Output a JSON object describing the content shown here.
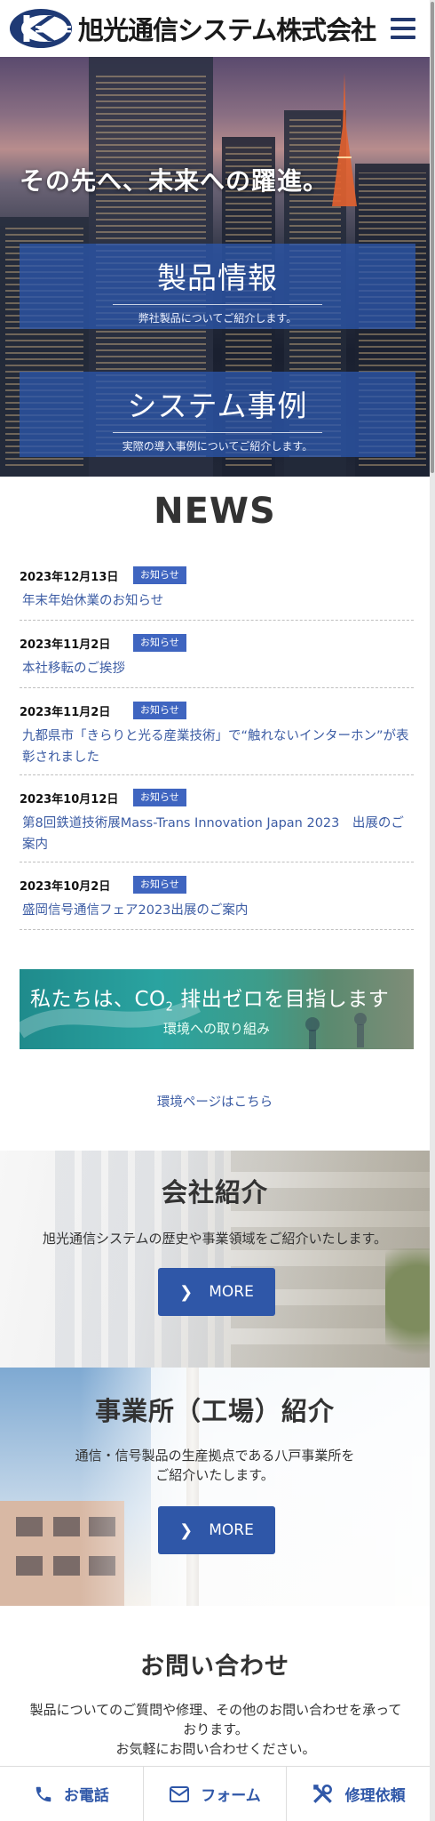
{
  "header": {
    "company_name": "旭光通信システム株式会社",
    "brand_color": "#1f3a75",
    "menu_icon": "hamburger-menu-icon"
  },
  "hero": {
    "tagline": "その先へ、未来への躍進。",
    "boxes": [
      {
        "title": "製品情報",
        "subtitle": "弊社製品についてご紹介します。"
      },
      {
        "title": "システム事例",
        "subtitle": "実際の導入事例についてご紹介します。"
      }
    ]
  },
  "news": {
    "heading": "NEWS",
    "badge_color": "#3f65c0",
    "items": [
      {
        "date": "2023年12月13日",
        "category": "お知らせ",
        "title": "年末年始休業のお知らせ"
      },
      {
        "date": "2023年11月2日",
        "category": "お知らせ",
        "title": "本社移転のご挨拶"
      },
      {
        "date": "2023年11月2日",
        "category": "お知らせ",
        "title": "九都県市「きらりと光る産業技術」で“触れないインターホン”が表彰されました"
      },
      {
        "date": "2023年10月12日",
        "category": "お知らせ",
        "title": "第8回鉄道技術展Mass-Trans Innovation Japan 2023　出展のご案内"
      },
      {
        "date": "2023年10月2日",
        "category": "お知らせ",
        "title": "盛岡信号通信フェア2023出展のご案内"
      }
    ]
  },
  "eco": {
    "banner_pre": "私たちは、CO",
    "banner_sub": "2",
    "banner_post": " 排出ゼロを目指します",
    "banner_line2": "環境への取り組み",
    "link": "環境ページはこちら"
  },
  "company": {
    "title": "会社紹介",
    "text": "旭光通信システムの歴史や事業領域をご紹介いたします。",
    "more_label": "MORE"
  },
  "office": {
    "title": "事業所（工場）紹介",
    "text_line1": "通信・信号製品の生産拠点である八戸事業所を",
    "text_line2": "ご紹介いたします。",
    "more_label": "MORE"
  },
  "contact": {
    "title": "お問い合わせ",
    "text_line1": "製品についてのご質問や修理、その他のお問い合わせを承っております。",
    "text_line2": "お気軽にお問い合わせください。"
  },
  "bottom_bar": {
    "accent": "#2f57a8",
    "items": [
      {
        "label": "お電話",
        "icon": "phone-icon"
      },
      {
        "label": "フォーム",
        "icon": "mail-icon"
      },
      {
        "label": "修理依頼",
        "icon": "tools-icon"
      }
    ]
  }
}
